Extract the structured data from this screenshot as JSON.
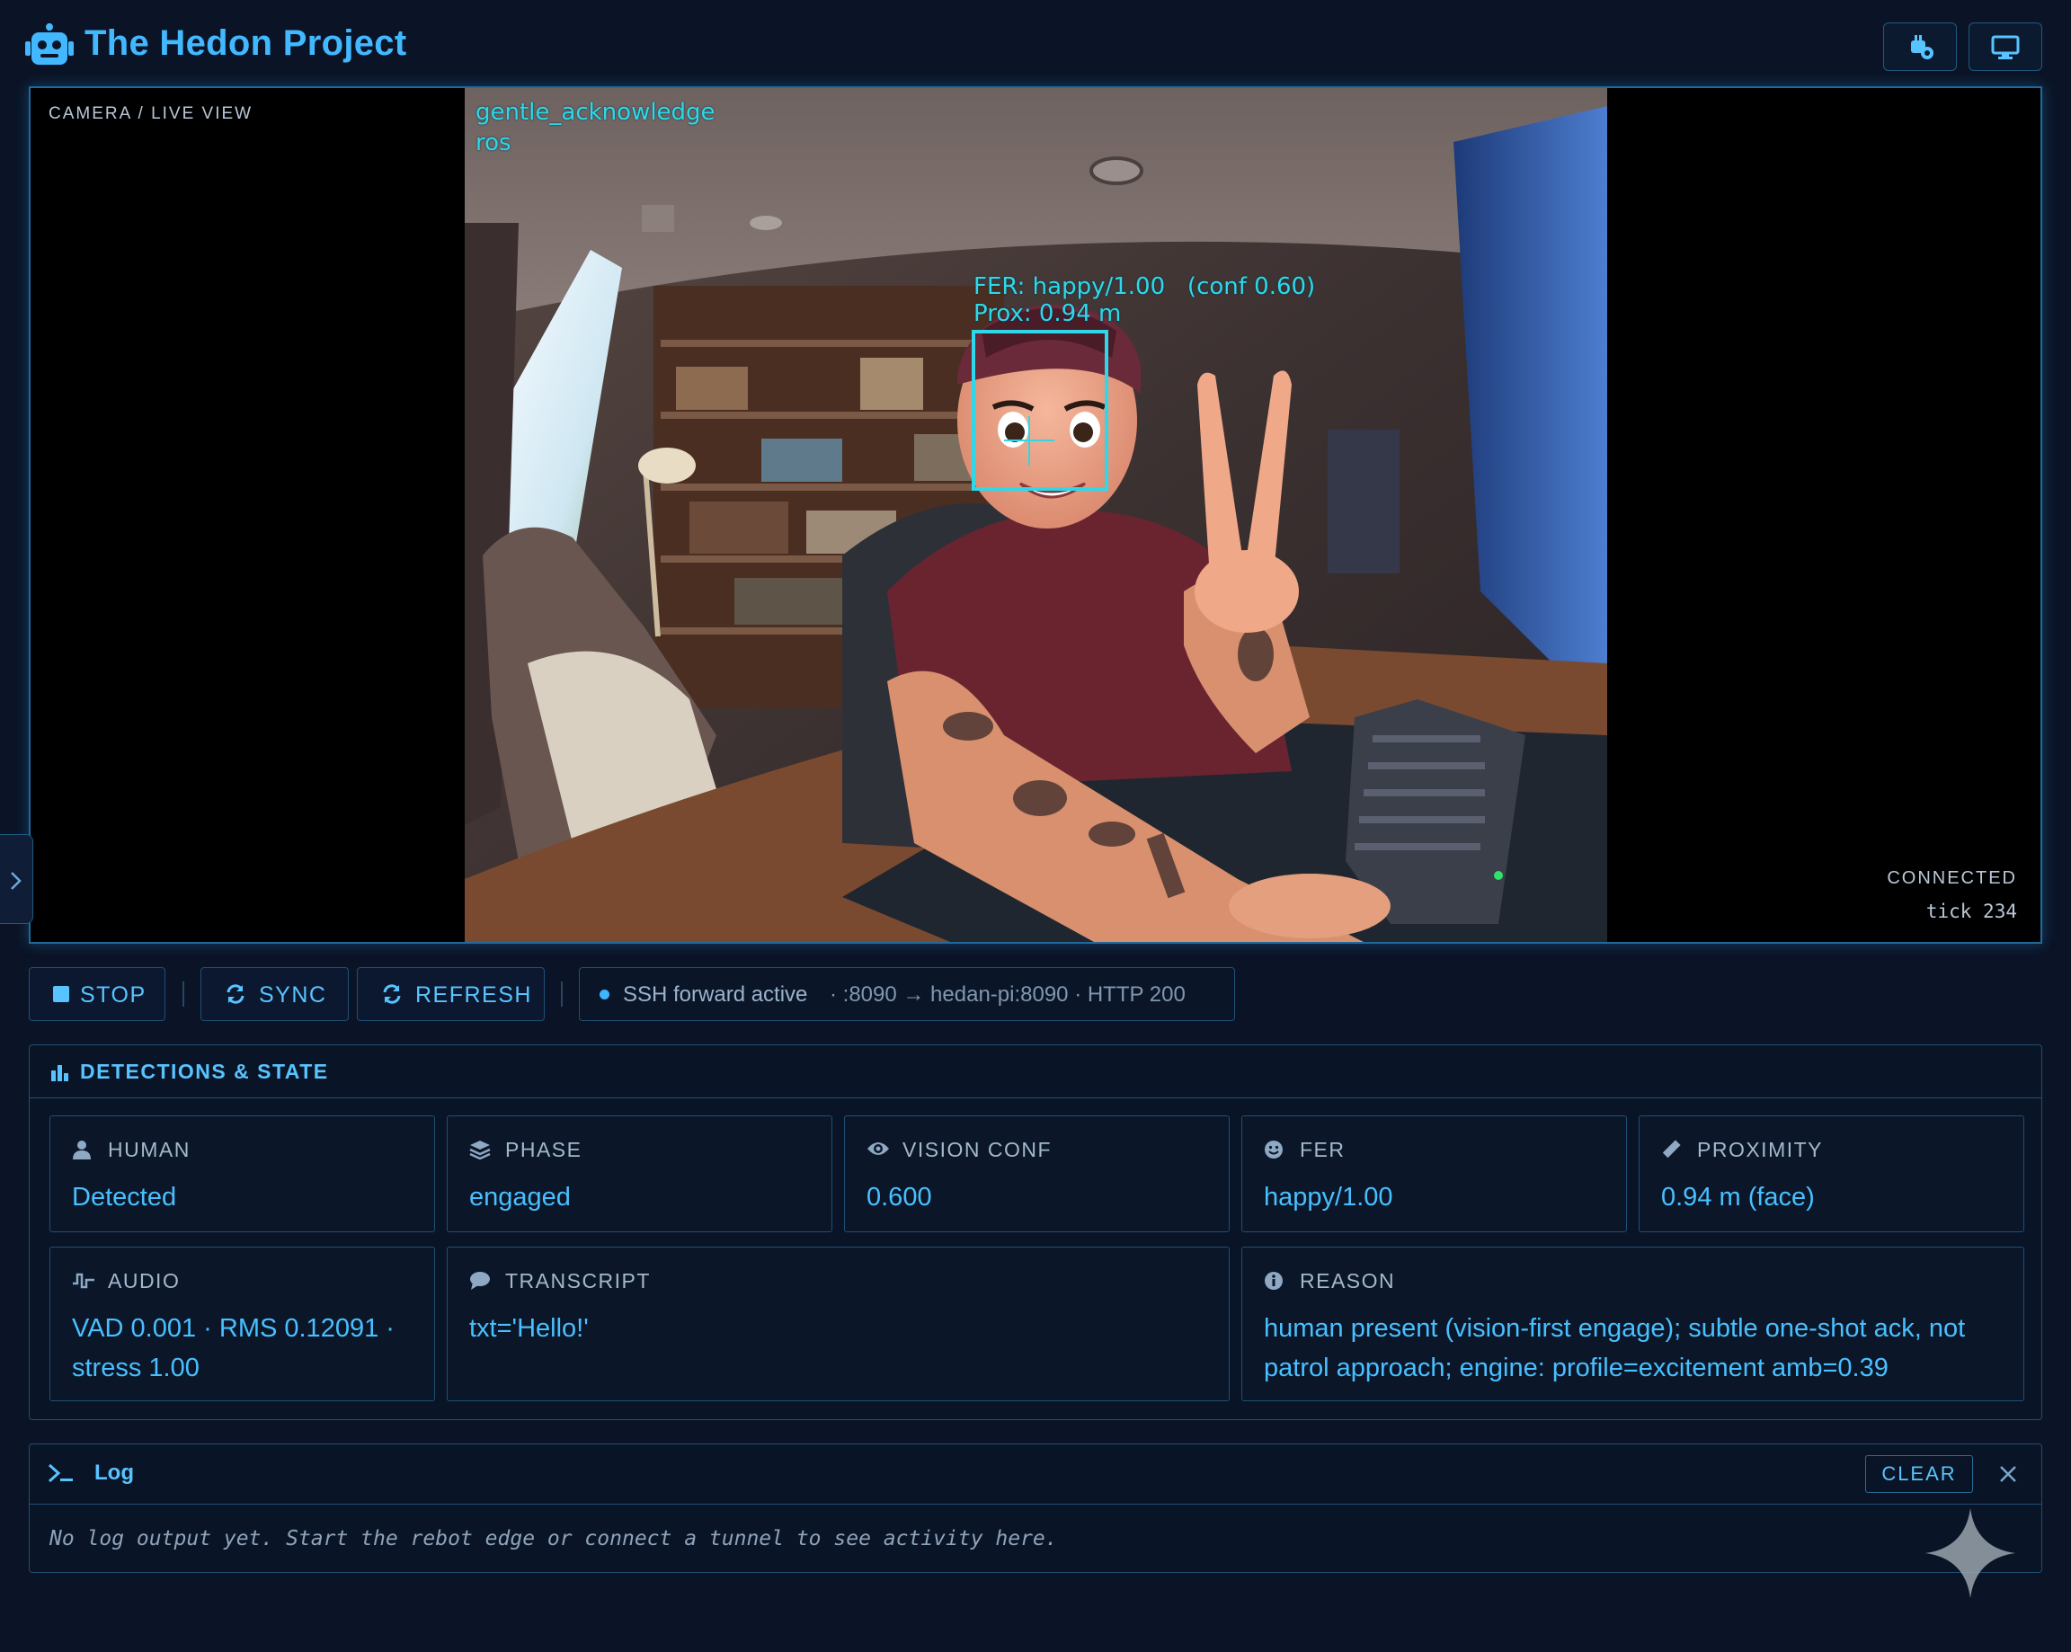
{
  "app": {
    "title": "The Hedon Project"
  },
  "camera": {
    "label": "CAMERA / LIVE VIEW",
    "status": "CONNECTED",
    "tick": "tick 234",
    "overlay_top": [
      "gentle_acknowledge",
      "ros"
    ],
    "fer_line": "FER: happy/1.00   (conf 0.60)",
    "prox_line": "Prox: 0.94 m"
  },
  "controls": {
    "stop": "STOP",
    "sync": "SYNC",
    "refresh": "REFRESH",
    "ssh_status": "SSH forward active",
    "ssh_detail": "· :8090 → hedan-pi:8090 · HTTP 200"
  },
  "detections": {
    "title": "DETECTIONS & STATE",
    "cards": [
      {
        "key": "HUMAN",
        "value": "Detected",
        "icon": "user-icon"
      },
      {
        "key": "PHASE",
        "value": "engaged",
        "icon": "layers-icon"
      },
      {
        "key": "VISION CONF",
        "value": "0.600",
        "icon": "eye-icon"
      },
      {
        "key": "FER",
        "value": "happy/1.00",
        "icon": "smile-icon"
      },
      {
        "key": "PROXIMITY",
        "value": "0.94 m (face)",
        "icon": "ruler-icon"
      },
      {
        "key": "AUDIO",
        "value": "VAD 0.001 · RMS 0.12091 · stress 1.00",
        "icon": "wave-icon"
      },
      {
        "key": "TRANSCRIPT",
        "value": "txt='Hello!'",
        "icon": "chat-icon"
      },
      {
        "key": "REASON",
        "value": "human present (vision-first engage); subtle one-shot ack, not patrol approach; engine: profile=excitement amb=0.39",
        "icon": "info-icon"
      }
    ]
  },
  "log": {
    "title": "Log",
    "clear": "CLEAR",
    "empty_message": "No log output yet. Start the rebot edge or connect a tunnel to see activity here."
  },
  "colors": {
    "accent": "#41b8ff",
    "overlay": "#2fd8e8",
    "background": "#0b1426"
  }
}
